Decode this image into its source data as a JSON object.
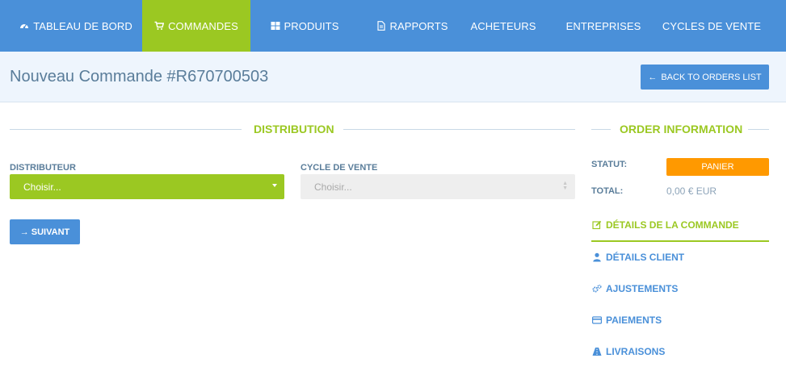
{
  "nav": {
    "items": [
      {
        "label": "TABLEAU DE BORD",
        "icon": "dashboard-icon"
      },
      {
        "label": "COMMANDES",
        "icon": "cart-icon",
        "active": true
      },
      {
        "label": "PRODUITS",
        "icon": "grid-icon"
      },
      {
        "label": "RAPPORTS",
        "icon": "file-icon"
      },
      {
        "label": "ACHETEURS"
      },
      {
        "label": "ENTREPRISES"
      },
      {
        "label": "CYCLES DE VENTE"
      }
    ]
  },
  "header": {
    "title": "Nouveau Commande #R670700503",
    "back_button": "BACK TO ORDERS LIST"
  },
  "distribution": {
    "heading": "DISTRIBUTION",
    "distributor_label": "DISTRIBUTEUR",
    "distributor_value": "Choisir...",
    "cycle_label": "CYCLE DE VENTE",
    "cycle_placeholder": "Choisir...",
    "next_button": "SUIVANT"
  },
  "order_info": {
    "heading": "ORDER INFORMATION",
    "status_label": "STATUT:",
    "status_value": "PANIER",
    "total_label": "TOTAL:",
    "total_value": "0,00 € EUR",
    "links": [
      {
        "label": "DÉTAILS DE LA COMMANDE",
        "icon": "edit-icon",
        "active": true
      },
      {
        "label": "DÉTAILS CLIENT",
        "icon": "user-icon"
      },
      {
        "label": "AJUSTEMENTS",
        "icon": "cogs-icon"
      },
      {
        "label": "PAIEMENTS",
        "icon": "credit-card-icon"
      },
      {
        "label": "LIVRAISONS",
        "icon": "truck-icon"
      }
    ]
  },
  "colors": {
    "nav_blue": "#4a90d9",
    "accent_green": "#9bc822",
    "status_orange": "#ff9900"
  }
}
